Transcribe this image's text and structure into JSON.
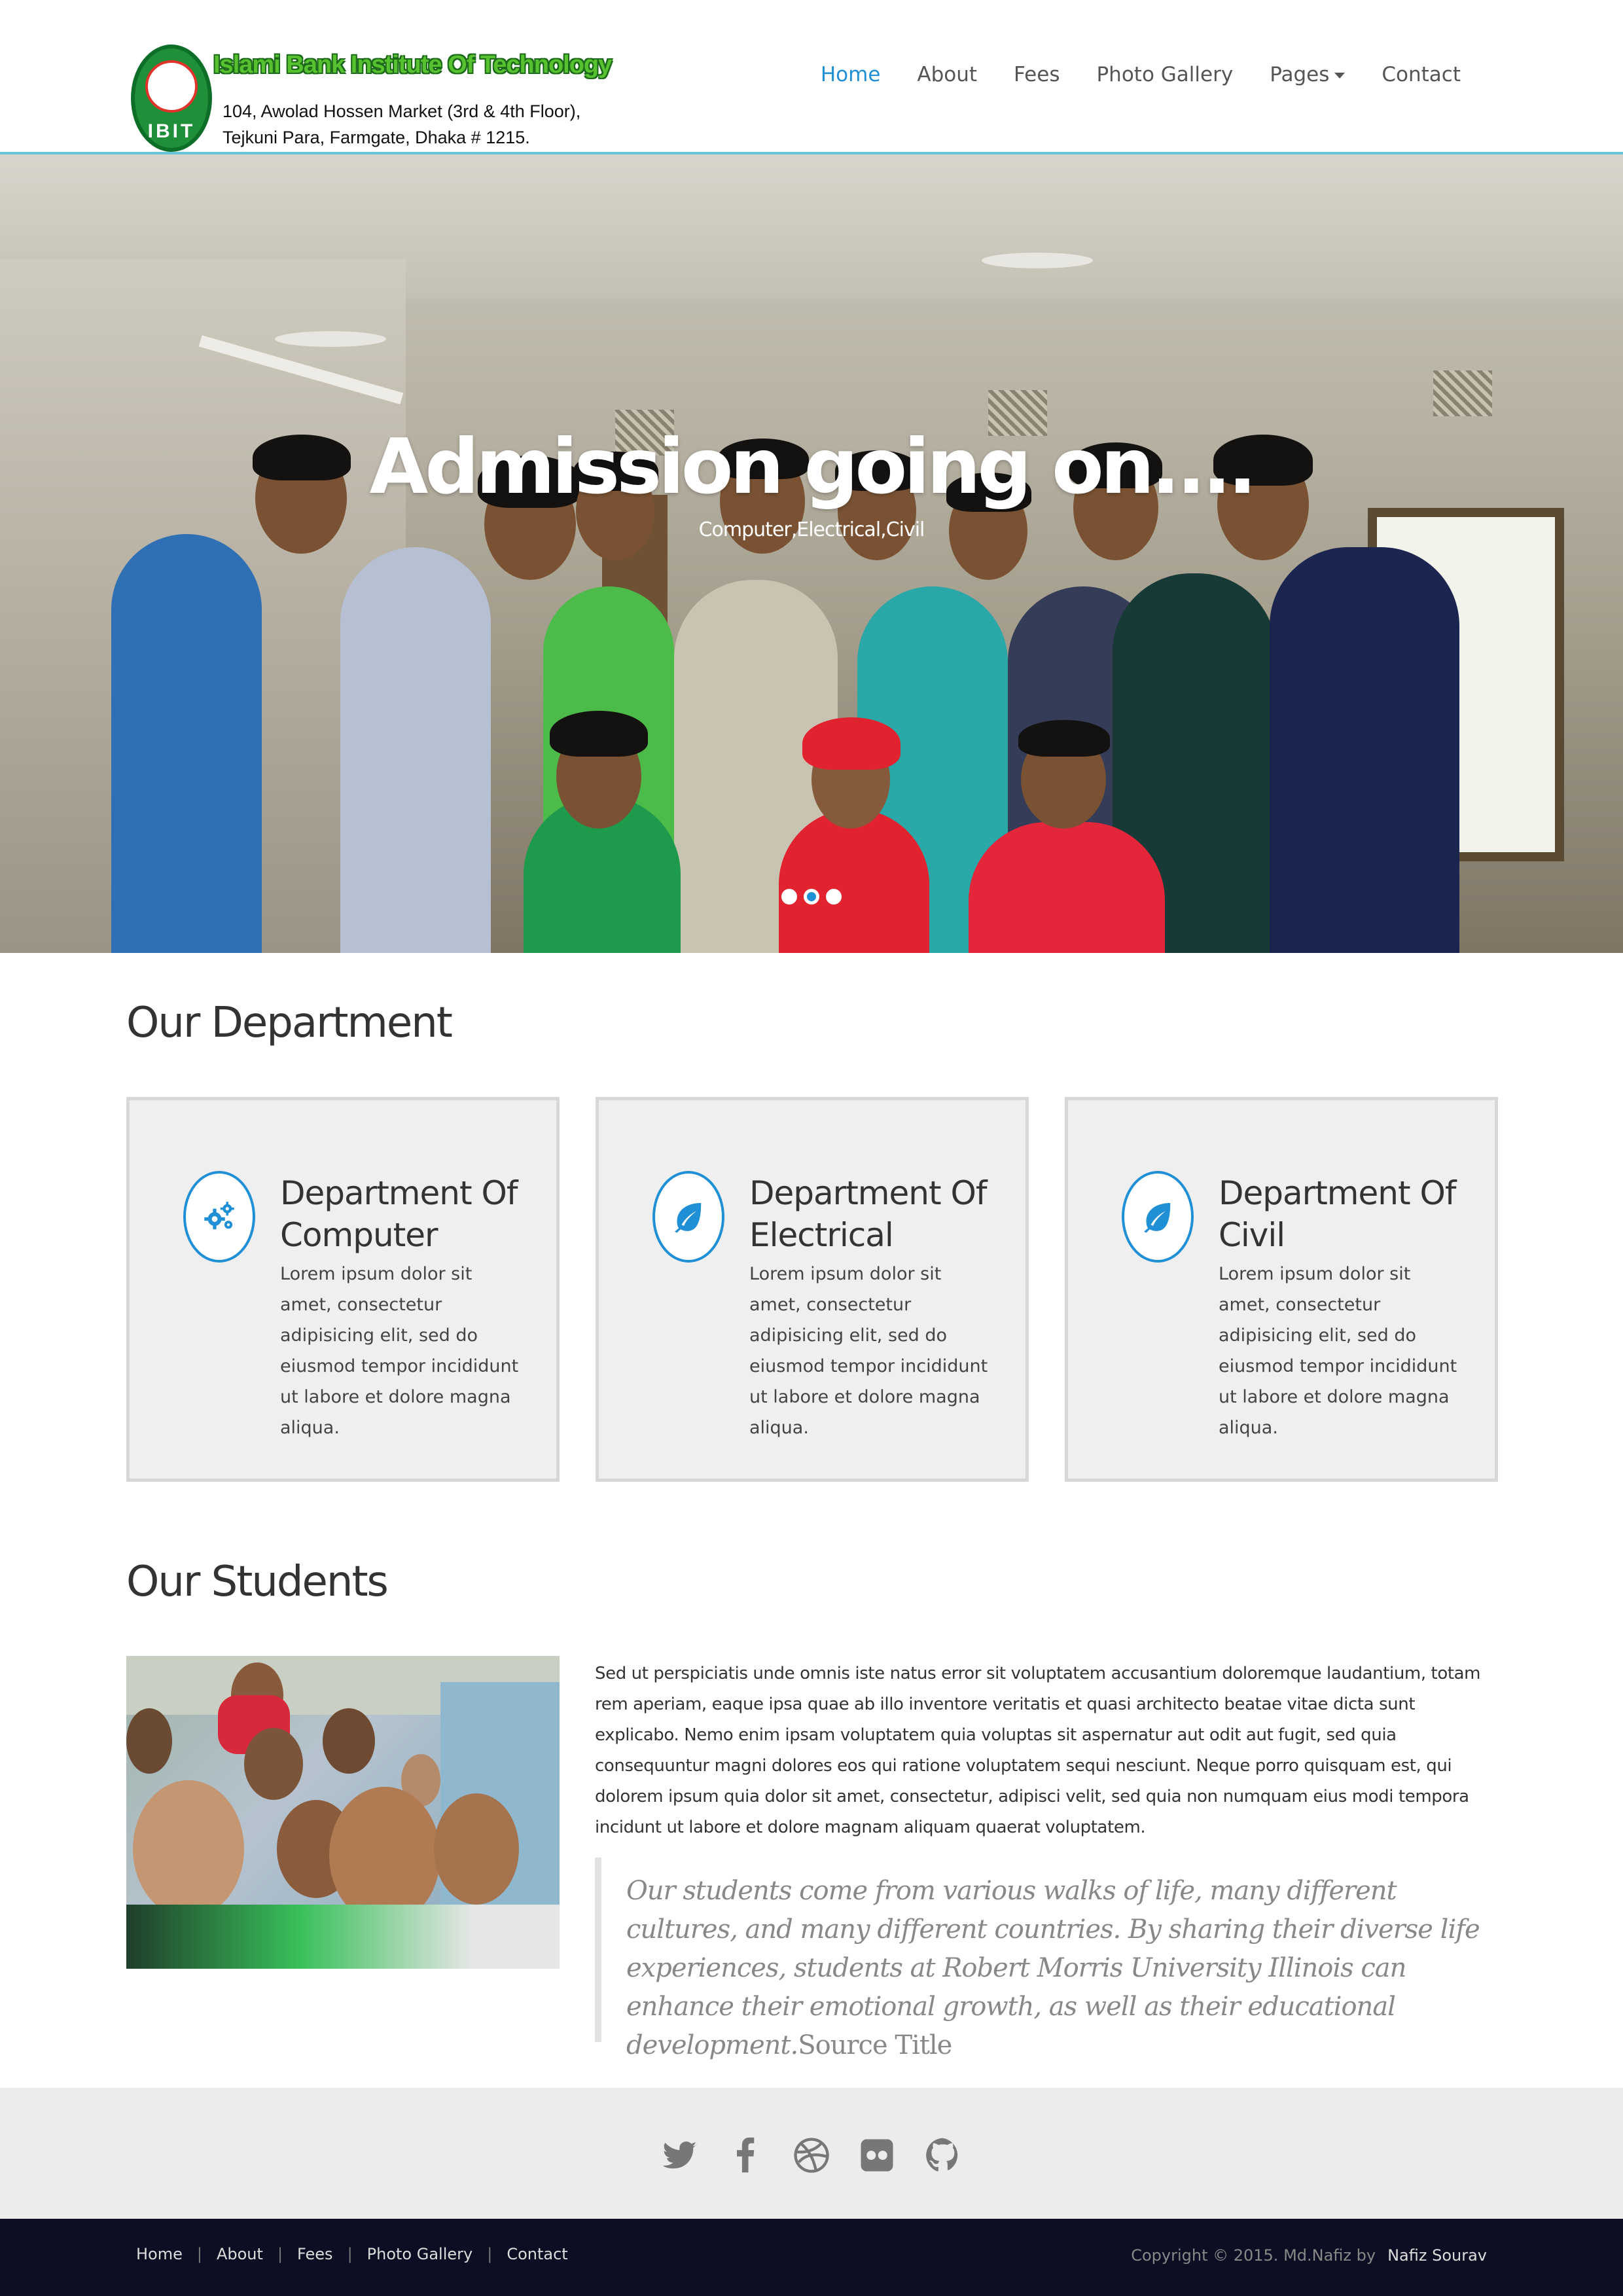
{
  "header": {
    "logo_title": "Islami Bank Institute Of Technology",
    "logo_addr_1": "104, Awolad Hossen Market (3rd & 4th Floor),",
    "logo_addr_2": "Tejkuni Para, Farmgate, Dhaka # 1215.",
    "seal_text": "IBIT",
    "nav": [
      {
        "label": "Home",
        "active": true
      },
      {
        "label": "About"
      },
      {
        "label": "Fees"
      },
      {
        "label": "Photo Gallery"
      },
      {
        "label": "Pages",
        "dropdown": true
      },
      {
        "label": "Contact"
      }
    ],
    "accent_color": "#1f8fd6"
  },
  "hero": {
    "title": "Admission going on....",
    "subtitle": "Computer,Electrical,Civil",
    "slides": 3,
    "active_slide": 2
  },
  "departments": {
    "title": "Our Department",
    "items": [
      {
        "name": "Department Of Computer",
        "line1": "Department Of",
        "line2": "Computer",
        "icon": "gears-icon",
        "text": "Lorem ipsum dolor sit amet, consectetur adipisicing elit, sed do eiusmod tempor incididunt ut labore et dolore magna aliqua."
      },
      {
        "name": "Department Of Electrical",
        "line1": "Department Of",
        "line2": "Electrical",
        "icon": "leaf-icon",
        "text": "Lorem ipsum dolor sit amet, consectetur adipisicing elit, sed do eiusmod tempor incididunt ut labore et dolore magna aliqua."
      },
      {
        "name": "Department Of Civil",
        "line1": "Department Of",
        "line2": "Civil",
        "icon": "leaf-icon",
        "text": "Lorem ipsum dolor sit amet, consectetur adipisicing elit, sed do eiusmod tempor incididunt ut labore et dolore magna aliqua."
      }
    ]
  },
  "students": {
    "title": "Our Students",
    "paragraph": "Sed ut perspiciatis unde omnis iste natus error sit voluptatem accusantium doloremque laudantium, totam rem aperiam, eaque ipsa quae ab illo inventore veritatis et quasi architecto beatae vitae dicta sunt explicabo. Nemo enim ipsam voluptatem quia voluptas sit aspernatur aut odit aut fugit, sed quia consequuntur magni dolores eos qui ratione voluptatem sequi nesciunt. Neque porro quisquam est, qui dolorem ipsum quia dolor sit amet, consectetur, adipisci velit, sed quia non numquam eius modi tempora incidunt ut labore et dolore magnam aliquam quaerat voluptatem.",
    "quote": "Our students come from various walks of life, many different cultures, and many different countries. By sharing their diverse life experiences, students at Robert Morris University Illinois can enhance their emotional growth, as well as their educational development.",
    "quote_source": "Source Title"
  },
  "social": [
    "twitter-icon",
    "facebook-icon",
    "dribbble-icon",
    "flickr-icon",
    "github-icon"
  ],
  "footer": {
    "links": [
      "Home",
      "About",
      "Fees",
      "Photo Gallery",
      "Contact"
    ],
    "copyright": "Copyright © 2015. Md.Nafiz by",
    "author": "Nafiz Sourav"
  }
}
